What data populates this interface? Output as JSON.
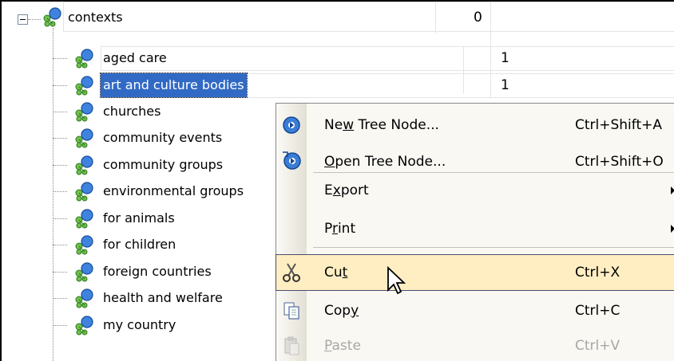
{
  "tree": {
    "root": {
      "label": "contexts",
      "value": "0"
    },
    "children": [
      {
        "label": "aged care",
        "value": "1"
      },
      {
        "label": "art and culture bodies",
        "value": "1",
        "selected": true
      },
      {
        "label": "churches"
      },
      {
        "label": "community events"
      },
      {
        "label": "community groups"
      },
      {
        "label": "environmental groups"
      },
      {
        "label": "for animals"
      },
      {
        "label": "for children"
      },
      {
        "label": "foreign countries"
      },
      {
        "label": "health and welfare"
      },
      {
        "label": "my country"
      }
    ]
  },
  "context_menu": {
    "items": [
      {
        "pre": "Ne",
        "mnemonic": "w",
        "post": " Tree Node...",
        "shortcut": "Ctrl+Shift+A",
        "icon": "new-tree-node-icon"
      },
      {
        "pre": "",
        "mnemonic": "O",
        "post": "pen Tree Node...",
        "shortcut": "Ctrl+Shift+O",
        "icon": "open-tree-node-icon"
      },
      {
        "pre": "E",
        "mnemonic": "x",
        "post": "port",
        "submenu": true
      },
      {
        "pre": "P",
        "mnemonic": "r",
        "post": "int",
        "submenu": true
      },
      {
        "pre": "Cu",
        "mnemonic": "t",
        "post": "",
        "shortcut": "Ctrl+X",
        "icon": "scissors-icon",
        "hover": true
      },
      {
        "pre": "Cop",
        "mnemonic": "y",
        "post": "",
        "shortcut": "Ctrl+C",
        "icon": "copy-icon"
      },
      {
        "pre": "",
        "mnemonic": "P",
        "post": "aste",
        "shortcut": "Ctrl+V",
        "icon": "paste-icon",
        "disabled": true
      }
    ]
  },
  "colors": {
    "selection": "#316ac5",
    "menu_hover": "#ffeec2",
    "menu_background": "#f9f8f3"
  }
}
